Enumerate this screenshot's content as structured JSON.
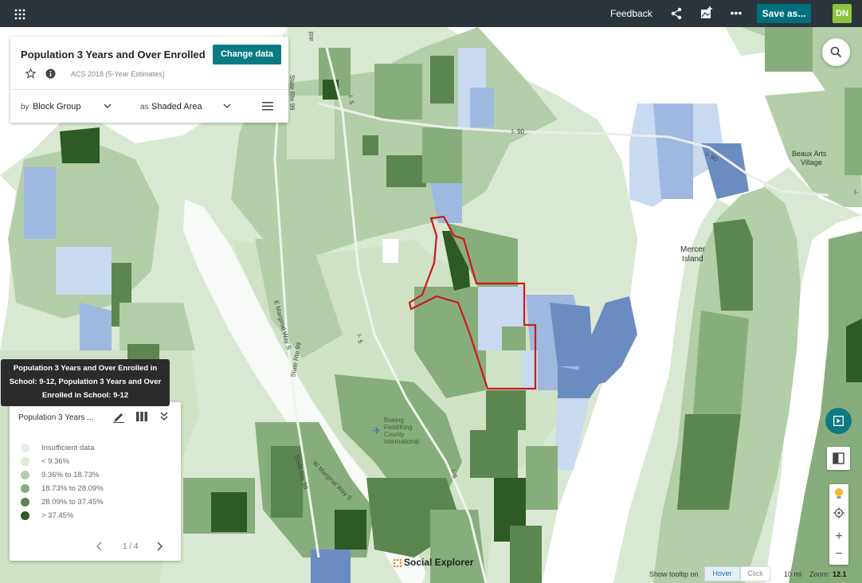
{
  "topbar": {
    "feedback_label": "Feedback",
    "save_label": "Save as...",
    "avatar_initials": "DN"
  },
  "panel": {
    "title": "Population 3 Years and Over Enrolled i...",
    "change_label": "Change data",
    "survey": "ACS 2018 (5-Year Estimates)",
    "by_label": "by",
    "by_value": "Block Group",
    "as_label": "as",
    "as_value": "Shaded Area"
  },
  "tooltip": {
    "lines": [
      "Population 3 Years and Over Enrolled in",
      "School: 9-12, Population 3 Years and Over",
      "Enrolled in School: 9-12"
    ]
  },
  "legend": {
    "title": "Population 3 Years ...",
    "items": [
      {
        "label": "Insufficient data",
        "color": "#e8ede8"
      },
      {
        "label": "< 9.36%",
        "color": "#dbe9d5"
      },
      {
        "label": "9.36% to 18.73%",
        "color": "#b3cea8"
      },
      {
        "label": "18.73% to 28.09%",
        "color": "#88ad7c"
      },
      {
        "label": "28.09% to 37.45%",
        "color": "#5b8650"
      },
      {
        "label": "> 37.45%",
        "color": "#2e5a25"
      }
    ],
    "pager": "1 / 4"
  },
  "map_labels": {
    "i90": "I- 90",
    "i90_east": "I- 90",
    "i5_north": "I- 5",
    "i5_mid": "I- 5",
    "i5_south": "I- 5",
    "sr99_north": "State Rte 99",
    "sr99_mid": "State Rte 99",
    "sr99_south": "State Rte 99",
    "e_marginal": "E Marginal Way S",
    "w_marginal": "W Marginal Way S",
    "boeing": "Boeing Field/King County International",
    "mercer": "Mercer Island",
    "beaux_arts": "Beaux Arts Village",
    "rte_top": "Rte",
    "i405_partial": "I-"
  },
  "colors": {
    "water": "#ffffff",
    "land_light": "#e3eedd",
    "green1": "#cfe2c6",
    "green2": "#b3cea8",
    "green3": "#88ad7c",
    "green4": "#5b8650",
    "green5": "#2e5a25",
    "blue_light": "#c9d9f0",
    "blue_mid": "#9fb8df",
    "blue_dark": "#6b8cc1",
    "selection": "#d01818",
    "accent": "#0a7b82"
  },
  "bottom": {
    "brand": "Social Explorer",
    "tooltip_label": "Show tooltip on",
    "hover_label": "Hover",
    "click_label": "Click",
    "scale": "10 mi",
    "zoom_label": "Zoom:",
    "zoom_value": "12.1"
  }
}
